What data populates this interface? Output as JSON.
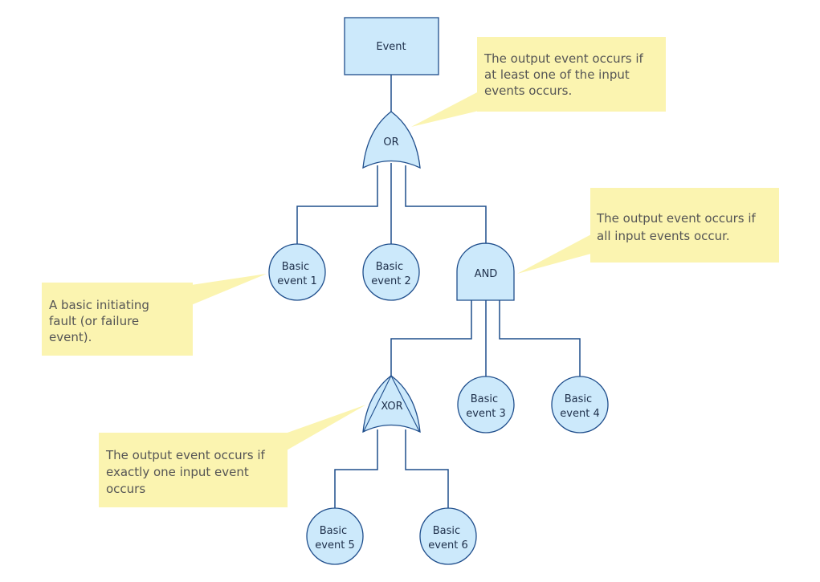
{
  "diagram": {
    "type": "fault-tree",
    "colors": {
      "node_fill": "#cce9fb",
      "node_stroke": "#1f4e8c",
      "callout_fill": "#fbf4b0",
      "callout_text": "#555555"
    },
    "nodes": {
      "top_event": {
        "label": "Event",
        "kind": "event-rectangle"
      },
      "or_gate": {
        "label": "OR",
        "kind": "or-gate"
      },
      "and_gate": {
        "label": "AND",
        "kind": "and-gate"
      },
      "xor_gate": {
        "label": "XOR",
        "kind": "xor-gate"
      },
      "basic1": {
        "line1": "Basic",
        "line2": "event 1",
        "kind": "basic-event"
      },
      "basic2": {
        "line1": "Basic",
        "line2": "event 2",
        "kind": "basic-event"
      },
      "basic3": {
        "line1": "Basic",
        "line2": "event 3",
        "kind": "basic-event"
      },
      "basic4": {
        "line1": "Basic",
        "line2": "event 4",
        "kind": "basic-event"
      },
      "basic5": {
        "line1": "Basic",
        "line2": "event 5",
        "kind": "basic-event"
      },
      "basic6": {
        "line1": "Basic",
        "line2": "event 6",
        "kind": "basic-event"
      }
    },
    "edges": [
      {
        "from": "top_event",
        "to": "or_gate"
      },
      {
        "from": "or_gate",
        "to": "basic1"
      },
      {
        "from": "or_gate",
        "to": "basic2"
      },
      {
        "from": "or_gate",
        "to": "and_gate"
      },
      {
        "from": "and_gate",
        "to": "xor_gate"
      },
      {
        "from": "and_gate",
        "to": "basic3"
      },
      {
        "from": "and_gate",
        "to": "basic4"
      },
      {
        "from": "xor_gate",
        "to": "basic5"
      },
      {
        "from": "xor_gate",
        "to": "basic6"
      }
    ],
    "callouts": {
      "or": {
        "target": "or_gate",
        "lines": [
          "The output event occurs if",
          "at least one of the input",
          "events occurs."
        ]
      },
      "and": {
        "target": "and_gate",
        "lines": [
          "The output event occurs if",
          "all input events occur."
        ]
      },
      "basic": {
        "target": "basic1",
        "lines": [
          "A basic initiating",
          "fault (or failure",
          "event)."
        ]
      },
      "xor": {
        "target": "xor_gate",
        "lines": [
          "The output event occurs if",
          "exactly one input event",
          "occurs"
        ]
      }
    }
  }
}
